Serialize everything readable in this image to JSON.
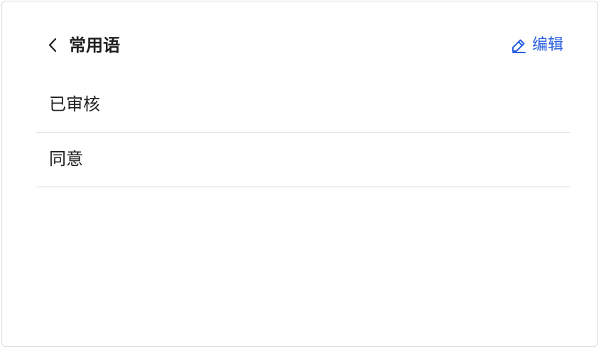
{
  "header": {
    "title": "常用语",
    "back_icon": "chevron-left-icon",
    "edit_label": "编辑",
    "edit_icon": "pencil-icon"
  },
  "colors": {
    "accent": "#2a5fe0",
    "text": "#1f1f1f",
    "divider": "#dedede"
  },
  "phrases": [
    {
      "label": "已审核"
    },
    {
      "label": "同意"
    }
  ]
}
